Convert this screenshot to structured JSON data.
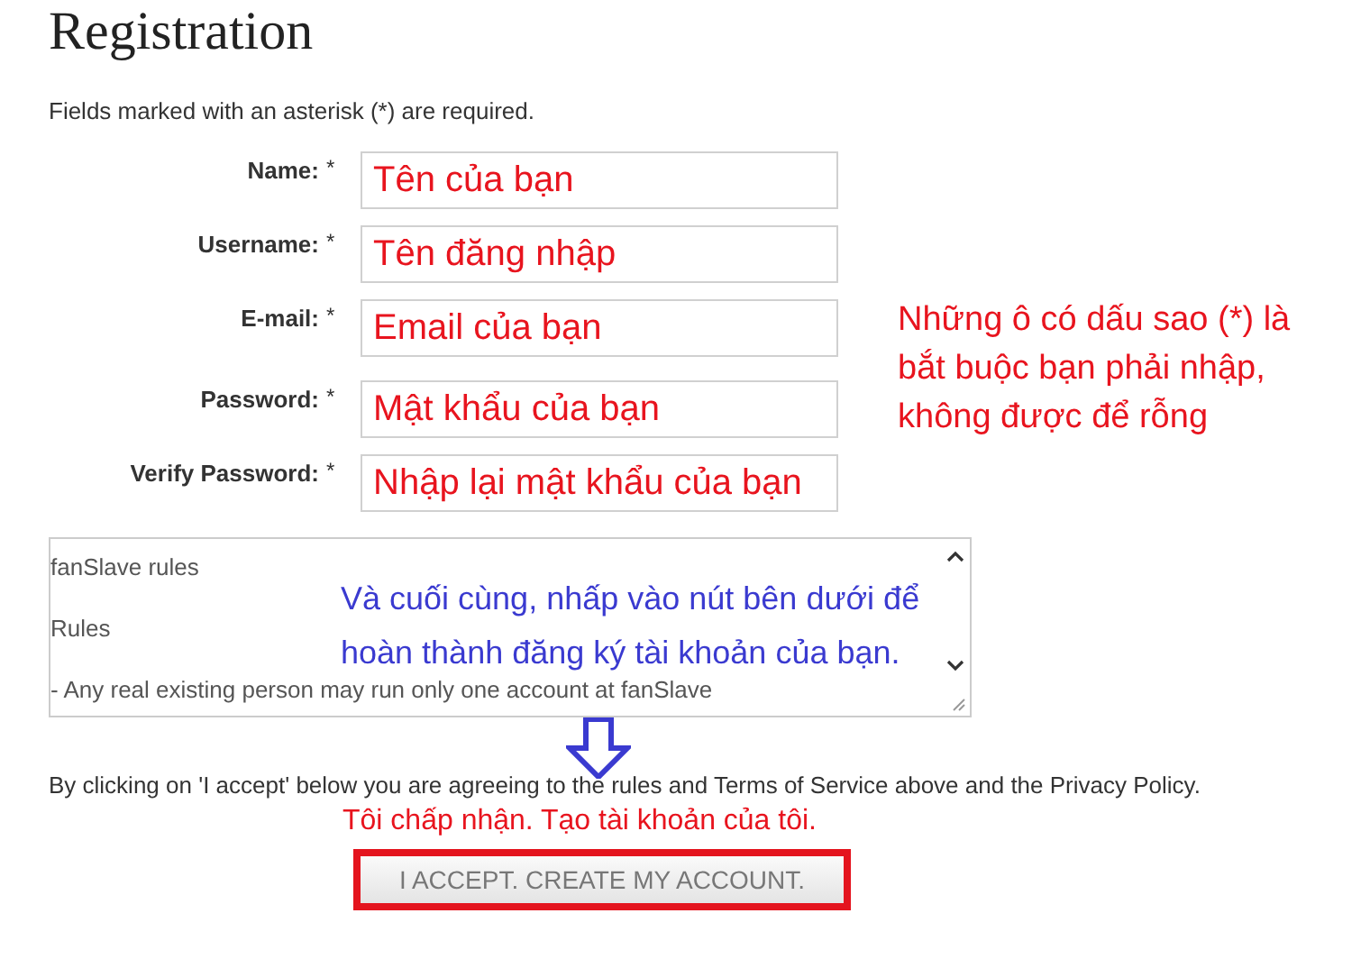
{
  "title": "Registration",
  "required_note": "Fields marked with an asterisk (*) are required.",
  "fields": [
    {
      "label": "Name:",
      "mark": "*",
      "value": "Tên của bạn"
    },
    {
      "label": "Username:",
      "mark": "*",
      "value": "Tên đăng nhập"
    },
    {
      "label": "E-mail:",
      "mark": "*",
      "value": "Email của bạn"
    },
    {
      "label": "Password:",
      "mark": "*",
      "value": "Mật khẩu của bạn"
    },
    {
      "label": "Verify Password:",
      "mark": "*",
      "value": "Nhập lại mật khẩu của bạn"
    }
  ],
  "rules_box": {
    "lines": [
      "fanSlave rules",
      "Rules",
      "-   Any real existing person may run only one account at fanSlave"
    ]
  },
  "agreement_text": "By clicking on 'I accept' below you are agreeing to the rules and Terms of Service above and the Privacy Policy.",
  "submit_button": {
    "label": "I ACCEPT. CREATE MY ACCOUNT.",
    "highlighted": true
  },
  "annotations": [
    {
      "kind": "side",
      "text": "Những ô có dấu sao (*) là bắt buộc bạn phải nhập, không được để rỗng",
      "color": "#e8141e"
    },
    {
      "kind": "over-rules",
      "text": "Và cuối cùng, nhấp vào nút bên dưới để hoàn thành đăng ký tài khoản của bạn.",
      "color": "#3a3ad0"
    },
    {
      "kind": "above-button",
      "text": "Tôi chấp nhận. Tạo tài khoản của tôi.",
      "color": "#e8141e"
    }
  ]
}
